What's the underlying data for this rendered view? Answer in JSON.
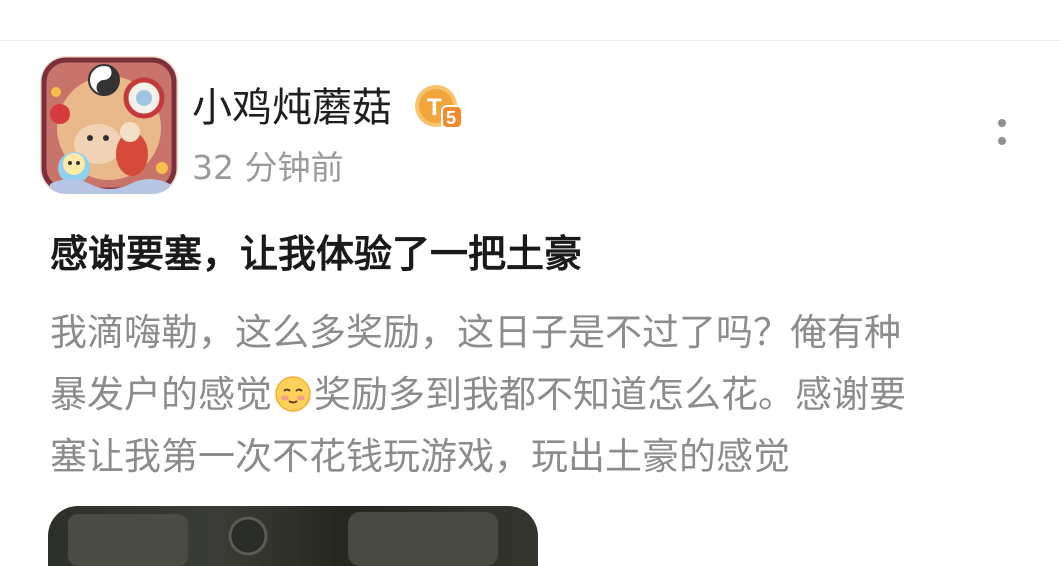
{
  "post": {
    "author": {
      "name": "小鸡炖蘑菇",
      "level_badge": "T5",
      "level_badge_color": "#f0a63a",
      "posted_time": "32 分钟前"
    },
    "more_icon": "more-vertical-icon",
    "title": "感谢要塞，让我体验了一把土豪",
    "body_lines": [
      {
        "before": "我滴嗨勒，这么多奖励，这日子是不过了吗？俺有种",
        "after": ""
      },
      {
        "before": "暴发户的感觉",
        "emoji": "shy-smile-emoji",
        "after": "奖励多到我都不知道怎么花。感谢要"
      },
      {
        "before": "塞让我第一次不花钱玩游戏，玩出土豪的感觉",
        "after": ""
      }
    ]
  },
  "colors": {
    "title_text": "#1a1a1a",
    "body_text": "#8c8c8c",
    "meta_text": "#9a9a9a"
  }
}
